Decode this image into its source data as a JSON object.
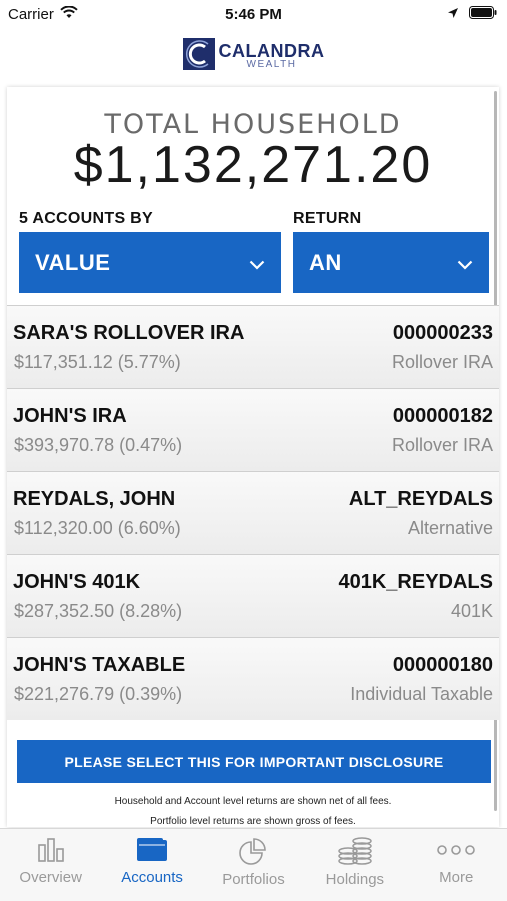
{
  "status_bar": {
    "carrier": "Carrier",
    "time": "5:46 PM"
  },
  "logo": {
    "name": "CALANDRA",
    "sub": "WEALTH"
  },
  "summary": {
    "label": "TOTAL HOUSEHOLD",
    "value": "$1,132,271.20"
  },
  "filters": {
    "accounts_by_label": "5 ACCOUNTS BY",
    "accounts_by_value": "VALUE",
    "return_label": "RETURN",
    "return_value": "AN"
  },
  "accounts": [
    {
      "name": "SARA'S ROLLOVER IRA",
      "value": "$117,351.12 (5.77%)",
      "number": "000000233",
      "type": "Rollover IRA"
    },
    {
      "name": "JOHN'S IRA",
      "value": "$393,970.78 (0.47%)",
      "number": "000000182",
      "type": "Rollover IRA"
    },
    {
      "name": "REYDALS, JOHN",
      "value": "$112,320.00 (6.60%)",
      "number": "ALT_REYDALS",
      "type": "Alternative"
    },
    {
      "name": "JOHN'S 401K",
      "value": "$287,352.50 (8.28%)",
      "number": "401K_REYDALS",
      "type": "401K"
    },
    {
      "name": "JOHN'S TAXABLE",
      "value": "$221,276.79 (0.39%)",
      "number": "000000180",
      "type": "Individual Taxable"
    }
  ],
  "disclosure": {
    "button_label": "PLEASE SELECT THIS FOR IMPORTANT DISCLOSURE",
    "note1": "Household and Account level returns are shown net of all fees.",
    "note2": "Portfolio level returns are shown gross of fees."
  },
  "tabs": [
    {
      "label": "Overview"
    },
    {
      "label": "Accounts"
    },
    {
      "label": "Portfolios"
    },
    {
      "label": "Holdings"
    },
    {
      "label": "More"
    }
  ],
  "colors": {
    "accent": "#1866c4",
    "brand": "#1f2e6b",
    "muted": "#8a8a8a"
  }
}
